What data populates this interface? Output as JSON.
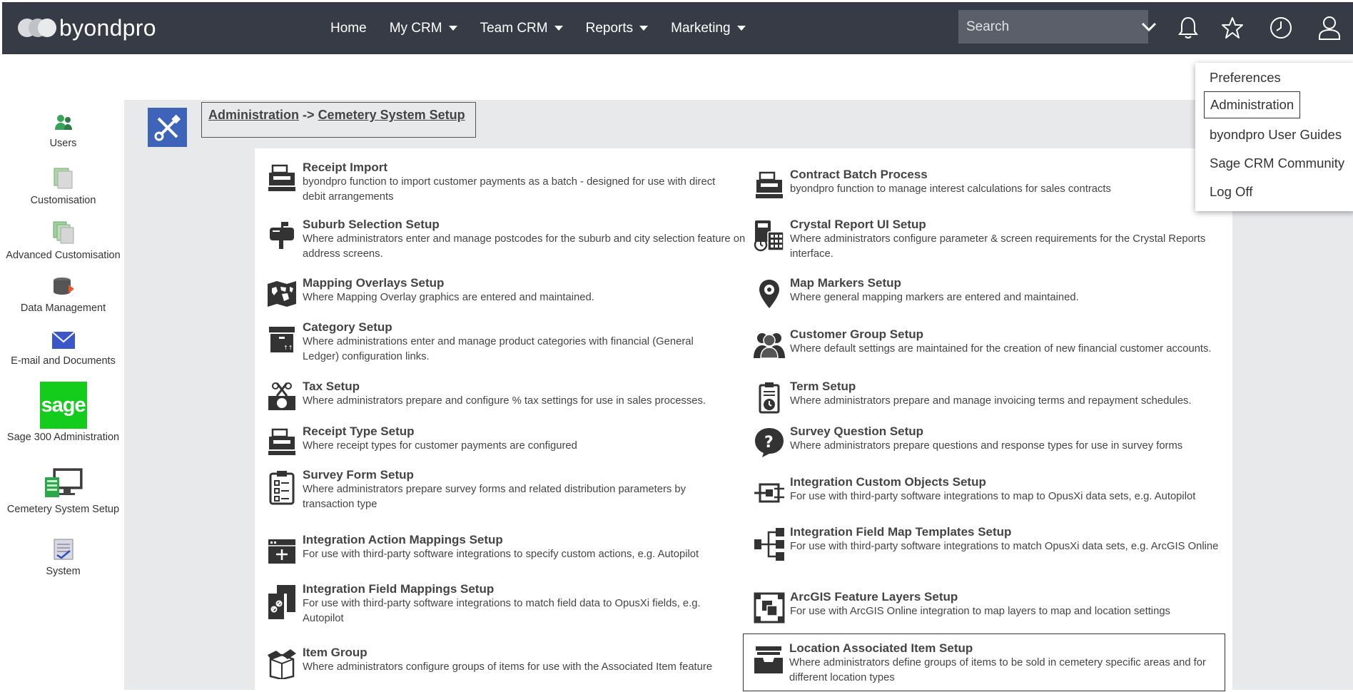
{
  "brand": {
    "name": "byondpro"
  },
  "nav": [
    {
      "label": "Home",
      "has_menu": false
    },
    {
      "label": "My CRM",
      "has_menu": true
    },
    {
      "label": "Team CRM",
      "has_menu": true
    },
    {
      "label": "Reports",
      "has_menu": true
    },
    {
      "label": "Marketing",
      "has_menu": true
    }
  ],
  "search": {
    "placeholder": "Search"
  },
  "top_icons": [
    "bell-icon",
    "star-icon",
    "clock-icon",
    "user-icon"
  ],
  "user_menu": [
    {
      "label": "Preferences"
    },
    {
      "label": "Administration",
      "selected": true
    },
    {
      "label": "byondpro User Guides"
    },
    {
      "label": "Sage CRM Community"
    },
    {
      "label": "Log Off"
    }
  ],
  "sidebar": [
    {
      "label": "Users",
      "icon": "users-icon"
    },
    {
      "label": "Customisation",
      "icon": "customisation-icon"
    },
    {
      "label": "Advanced Customisation",
      "icon": "advanced-customisation-icon"
    },
    {
      "label": "Data Management",
      "icon": "data-management-icon"
    },
    {
      "label": "E-mail and Documents",
      "icon": "email-icon"
    },
    {
      "label": "Sage 300 Administration",
      "icon": "sage-logo-icon",
      "logo_text": "sage"
    },
    {
      "label": "Cemetery System Setup",
      "icon": "cemetery-setup-icon"
    },
    {
      "label": "System",
      "icon": "system-icon"
    }
  ],
  "breadcrumb": {
    "parent": "Administration",
    "separator": "->",
    "current": "Cemetery System Setup"
  },
  "entries_left": [
    {
      "title": "Receipt Import",
      "desc": "byondpro function to import customer payments as a batch - designed for use with direct debit arrangements",
      "icon": "register-icon"
    },
    {
      "title": "Suburb Selection Setup",
      "desc": "Where administrators enter and manage postcodes for the suburb and city selection feature on address screens.",
      "icon": "mailbox-icon"
    },
    {
      "title": "Mapping Overlays Setup",
      "desc": "Where Mapping Overlay graphics are entered and maintained.",
      "icon": "world-map-icon"
    },
    {
      "title": "Category Setup",
      "desc": "Where administrations enter and manage product categories with financial (General Ledger) configuration links.",
      "icon": "box-icon"
    },
    {
      "title": "Tax Setup",
      "desc": "Where administrators prepare and configure % tax settings for use in sales processes.",
      "icon": "tax-icon"
    },
    {
      "title": "Receipt Type Setup",
      "desc": "Where receipt types for customer payments are configured",
      "icon": "register-icon"
    },
    {
      "title": "Survey Form Setup",
      "desc": "Where administrators prepare survey forms and related distribution parameters by transaction type",
      "icon": "clipboard-icon"
    },
    {
      "title": "Integration Action Mappings Setup",
      "desc": "For use with third-party software integrations to specify custom actions, e.g. Autopilot",
      "icon": "window-add-icon"
    },
    {
      "title": "Integration Field Mappings Setup",
      "desc": "For use with third-party software integrations to match field data to OpusXi fields, e.g. Autopilot",
      "icon": "file-link-icon"
    },
    {
      "title": "Item Group",
      "desc": "Where administrators configure groups of items for use with the Associated Item feature",
      "icon": "open-box-icon"
    }
  ],
  "entries_right": [
    {
      "title": "Contract Batch Process",
      "desc": "byondpro function to manage interest calculations for sales contracts",
      "icon": "register-icon"
    },
    {
      "title": "Crystal Report UI Setup",
      "desc": "Where administrators configure parameter & screen requirements for the Crystal Reports interface.",
      "icon": "calculator-icon"
    },
    {
      "title": "Map Markers Setup",
      "desc": "Where general mapping markers are entered and maintained.",
      "icon": "map-marker-icon"
    },
    {
      "title": "Customer Group Setup",
      "desc": "Where default settings are maintained for the creation of new financial customer accounts.",
      "icon": "group-icon"
    },
    {
      "title": "Term Setup",
      "desc": "Where administrators prepare and manage invoicing terms and repayment schedules.",
      "icon": "term-icon"
    },
    {
      "title": "Survey Question Setup",
      "desc": "Where administrators prepare questions and response types for use in survey forms",
      "icon": "question-icon"
    },
    {
      "title": "Integration Custom Objects Setup",
      "desc": "For use with third-party software integrations to map to OpusXi data sets, e.g. Autopilot",
      "icon": "integration-object-icon"
    },
    {
      "title": "Integration Field Map Templates Setup",
      "desc": "For use with third-party software integrations to match OpusXi data sets, e.g. ArcGIS Online",
      "icon": "hierarchy-icon"
    },
    {
      "title": "ArcGIS Feature Layers Setup",
      "desc": "For use with ArcGIS Online integration to map layers to map and location settings",
      "icon": "layers-icon"
    },
    {
      "title": "Location Associated Item Setup",
      "desc": "Where administrators define groups of items to be sold in cemetery specific areas and for different location types",
      "icon": "archive-icon",
      "selected": true
    }
  ]
}
